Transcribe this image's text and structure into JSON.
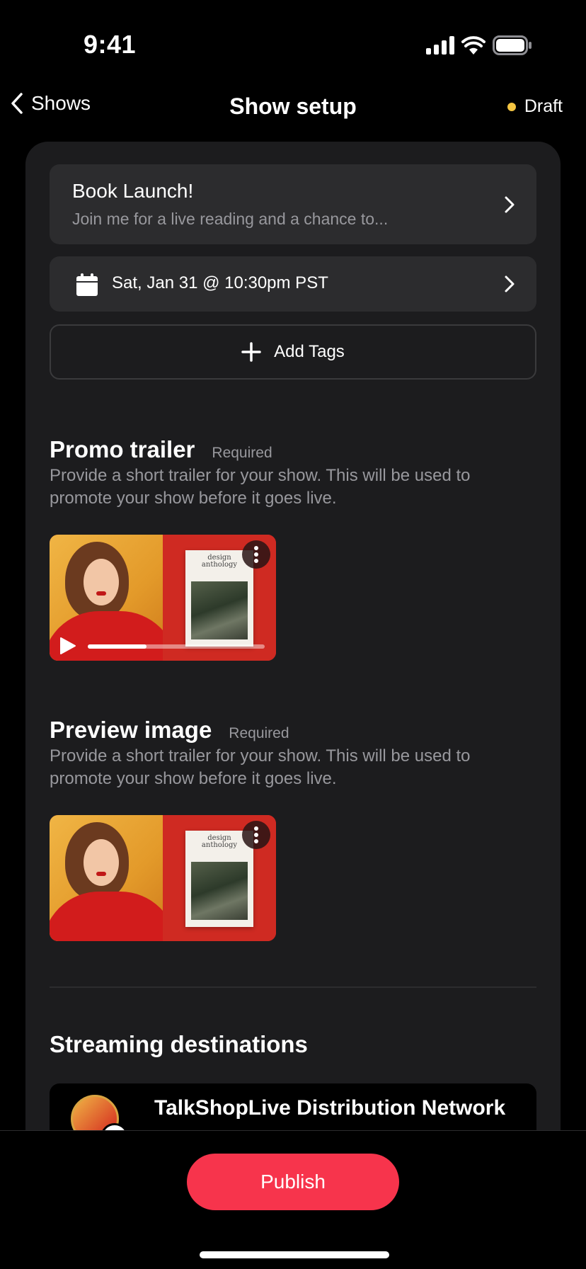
{
  "status_bar": {
    "time": "9:41"
  },
  "nav": {
    "back_label": "Shows",
    "title": "Show setup",
    "status": "Draft",
    "status_color": "#f4c542"
  },
  "show": {
    "title": "Book Launch!",
    "description": "Join me for a live reading and a chance to...",
    "schedule": "Sat, Jan 31 @ 10:30pm PST",
    "add_tags_label": "Add Tags"
  },
  "promo_trailer": {
    "title": "Promo trailer",
    "tag": "Required",
    "description": "Provide a short trailer for your show. This will be used to promote your show before it goes live.",
    "playback_progress": 0.33
  },
  "preview_image": {
    "title": "Preview image",
    "tag": "Required",
    "description": "Provide a short trailer for your show. This will be used to promote your show before it goes live."
  },
  "book_cover": {
    "title_line1": "design",
    "title_line2": "anthology"
  },
  "streaming": {
    "title": "Streaming destinations",
    "destinations": [
      {
        "name": "TalkShopLive Distribution Network"
      }
    ]
  },
  "publish_label": "Publish",
  "colors": {
    "accent": "#f7344c",
    "card": "#1c1c1e",
    "row": "#2c2c2e",
    "secondary_text": "#98989d"
  }
}
